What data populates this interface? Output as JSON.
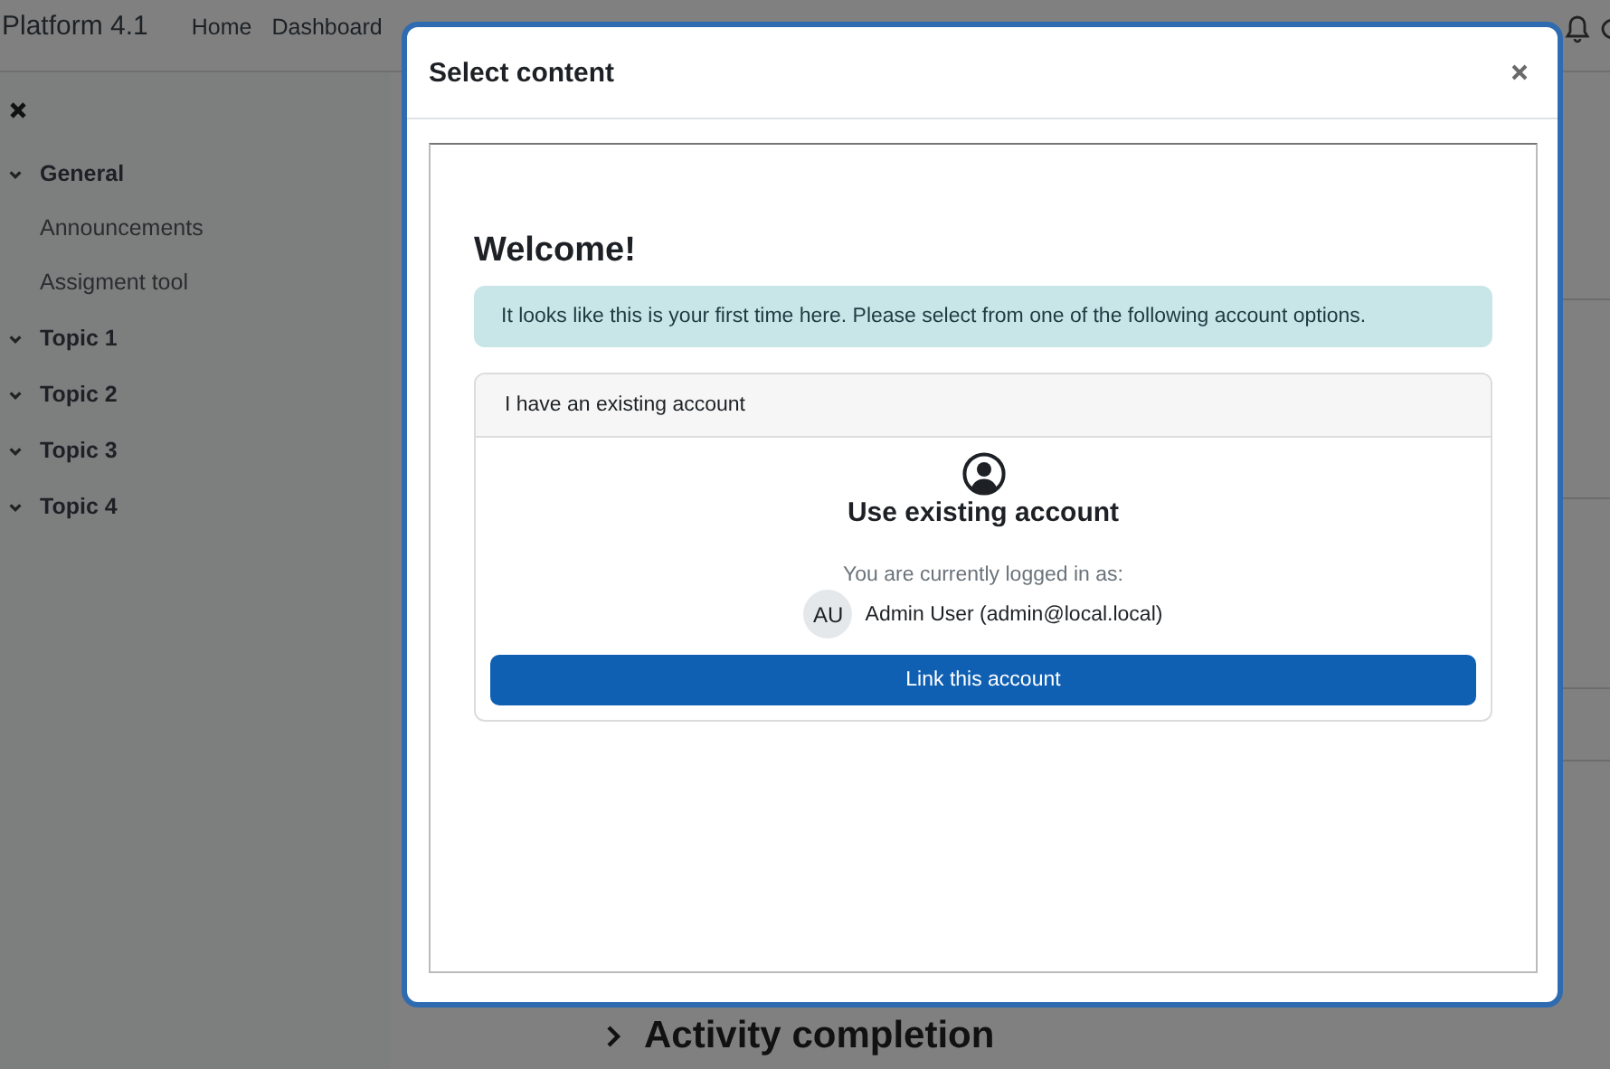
{
  "navbar": {
    "brand": "Platform 4.1",
    "links": [
      "Home",
      "Dashboard"
    ]
  },
  "sidebar": {
    "sections": [
      {
        "title": "General",
        "expanded": true,
        "children": [
          {
            "label": "Announcements"
          },
          {
            "label": "Assigment tool"
          }
        ]
      },
      {
        "title": "Topic 1",
        "expanded": true
      },
      {
        "title": "Topic 2",
        "expanded": true
      },
      {
        "title": "Topic 3",
        "expanded": true
      },
      {
        "title": "Topic 4",
        "expanded": true
      }
    ]
  },
  "main": {
    "section_heading": "Activity completion"
  },
  "modal": {
    "title": "Select content",
    "content": {
      "heading": "Welcome!",
      "alert": "It looks like this is your first time here. Please select from one of the following account options.",
      "card": {
        "header": "I have an existing account",
        "title": "Use existing account",
        "logged_in_label": "You are currently logged in as:",
        "avatar_initials": "AU",
        "user": "Admin User (admin@local.local)",
        "button": "Link this account"
      }
    }
  }
}
